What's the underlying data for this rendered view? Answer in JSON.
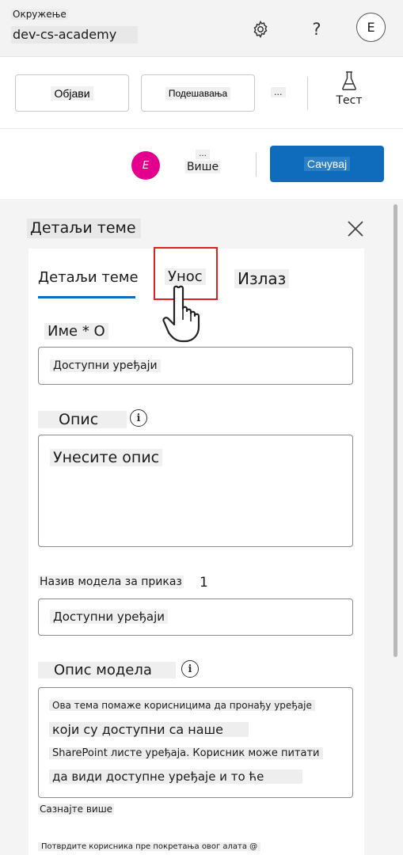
{
  "header": {
    "environment_label": "Окружење",
    "environment_name": "dev-cs-academy",
    "settings_icon": "gear-icon",
    "help_icon": "question-icon",
    "help_glyph": "?",
    "account_initial": "E"
  },
  "toolbar": {
    "publish_label": "Објави",
    "settings_label": "Подешавања",
    "more_label": "...",
    "test_label": "Тест",
    "test_icon": "flask-icon"
  },
  "savebar": {
    "user_initial": "E",
    "more_dots": "...",
    "more_label": "Више",
    "save_label": "Сачувај"
  },
  "panel": {
    "title": "Детаљи теме",
    "close_icon": "close-icon",
    "tabs": [
      {
        "label": "Детаљи теме",
        "selected": true
      },
      {
        "label": "Унос",
        "selected": false
      },
      {
        "label": "Излаз",
        "selected": false
      }
    ],
    "name_label": "Име * О",
    "name_value": "Доступни уређаји",
    "description_label": "Опис",
    "description_placeholder": "Унесите опис",
    "display_name_label": "Назив модела за приказ",
    "display_name_count": "1",
    "display_name_value": "Доступни уређаји",
    "model_description_label": "Опис модела",
    "model_description_lines": [
      "Ова тема помаже корисницима да пронађу уређаје",
      "који су доступни са наше",
      "SharePoint листе уређаја. Корисник може питати",
      "да види доступне уређаје и то ће"
    ],
    "learn_more": "Сазнајте више",
    "confirm_text": "Потврдите корисника пре покретања овог алата @"
  },
  "colors": {
    "accent": "#0f6cbd",
    "avatar": "#e3008c",
    "highlight": "#e02020"
  }
}
